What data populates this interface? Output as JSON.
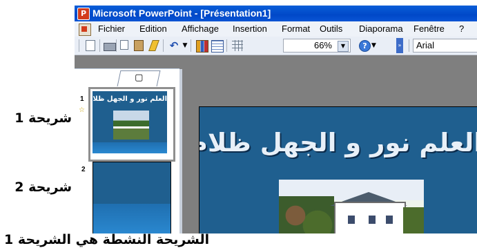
{
  "window": {
    "title": "Microsoft PowerPoint - [Présentation1]"
  },
  "menu": {
    "items": [
      "Fichier",
      "Edition",
      "Affichage",
      "Insertion",
      "Format",
      "Outils",
      "Diaporama",
      "Fenêtre",
      "?"
    ]
  },
  "toolbar": {
    "zoom": "66%",
    "font": "Arial",
    "icons": [
      "new-icon",
      "print-icon",
      "copy-icon",
      "paste-icon",
      "format-painter-icon",
      "undo-icon",
      "chart-icon",
      "table-icon",
      "grid-icon",
      "help-icon"
    ]
  },
  "panel": {
    "tabs": {
      "outline_glyph": "≣",
      "slides_glyph": "▢",
      "close_glyph": "×"
    },
    "slides": [
      {
        "number": "1",
        "star": "☆",
        "title": "العلم نور و الجهل ظلام"
      },
      {
        "number": "2"
      }
    ]
  },
  "slide": {
    "title": "العلم نور و الجهل ظلام"
  },
  "annotations": {
    "slide1": "شريحة 1",
    "slide2": "شريحة 2",
    "active_note": "الشريحة النشطة هي الشريحة 1"
  },
  "colors": {
    "titlebar": "#0a4fd0",
    "slide_bg": "#1f5f8f",
    "workspace": "#7f7f7f"
  }
}
